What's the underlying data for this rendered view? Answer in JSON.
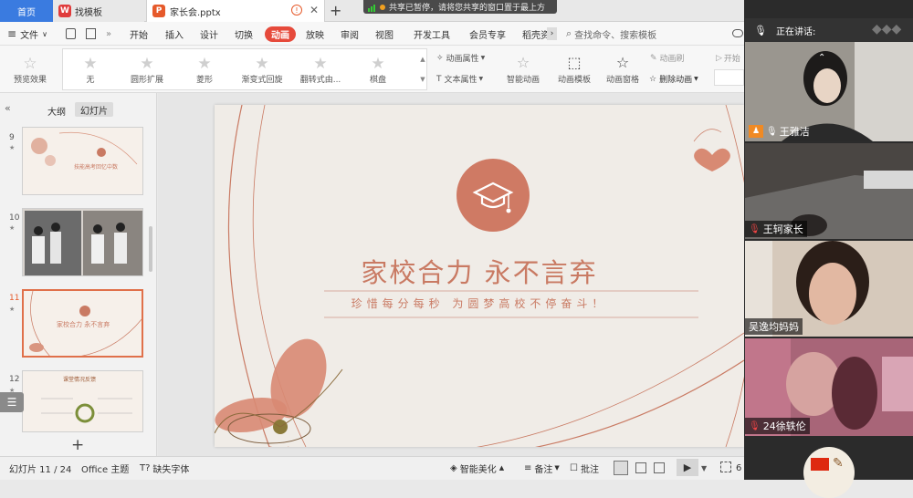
{
  "tabs": {
    "home": "首页",
    "template": "找模板",
    "file": "家长会.pptx",
    "add": "+"
  },
  "share_banner": "共享已暂停，请将您共享的窗口置于最上方",
  "menu": {
    "file": "文件",
    "items": [
      "开始",
      "插入",
      "设计",
      "切换",
      "动画",
      "放映",
      "审阅",
      "视图",
      "开发工具",
      "会员专享",
      "稻壳资"
    ],
    "active": "动画",
    "search": "查找命令、搜索模板"
  },
  "ribbon": {
    "preview": "预览效果",
    "effects": [
      "无",
      "圆形扩展",
      "菱形",
      "渐变式回旋",
      "翻转式由...",
      "棋盘"
    ],
    "anim_props": "动画属性",
    "text_props": "文本属性",
    "smart_anim": "智能动画",
    "anim_template": "动画模板",
    "anim_pane": "动画窗格",
    "anim_brush": "动画刷",
    "delete_anim": "删除动画",
    "start": "开始"
  },
  "panel": {
    "outline": "大纲",
    "slides": "幻灯片"
  },
  "thumbnails": [
    {
      "num": "9",
      "title": "技能高考回忆中数"
    },
    {
      "num": "10"
    },
    {
      "num": "11",
      "title": "家校合力 永不言弃",
      "active": true
    },
    {
      "num": "12",
      "title": "课堂情况反馈"
    }
  ],
  "slide": {
    "title": "家校合力  永不言弃",
    "subtitle": "珍惜每分每秒    为圆梦高校不停奋斗！"
  },
  "status": {
    "slide_pos": "幻灯片 11 / 24",
    "theme": "Office 主题",
    "missing_font": "缺失字体",
    "beautify": "智能美化",
    "notes": "备注",
    "comments": "批注",
    "zoom": "6"
  },
  "video": {
    "speaking_label": "正在讲话:",
    "participants": [
      {
        "name": "王雅洁"
      },
      {
        "name": "王轲家长"
      },
      {
        "name": "吴逸均妈妈"
      },
      {
        "name": "24徐轶伦"
      }
    ]
  },
  "colors": {
    "accent": "#e64a3b",
    "slide_rose": "#c97a63",
    "home_tab": "#3a7be0"
  }
}
